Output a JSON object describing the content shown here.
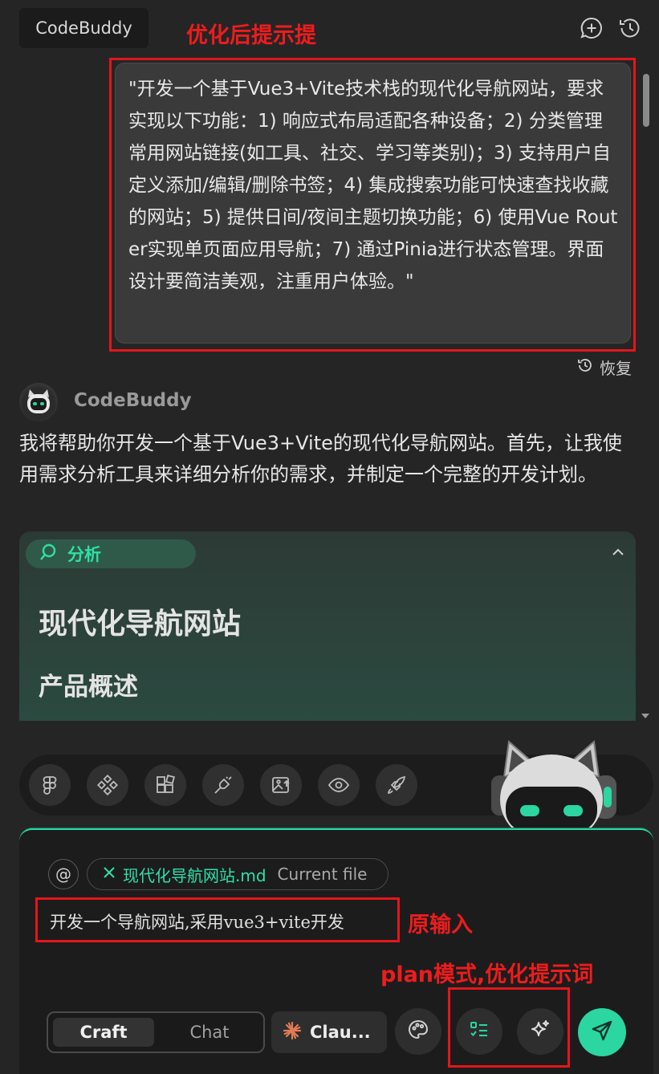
{
  "header": {
    "tab_label": "CodeBuddy",
    "new_chat_icon": "chat-plus-icon",
    "history_icon": "history-icon"
  },
  "annotations": {
    "optimized": "优化后提示提",
    "original": "原输入",
    "plan": "plan模式,优化提示词"
  },
  "prompt": {
    "text": "\"开发一个基于Vue3+Vite技术栈的现代化导航网站，要求实现以下功能：1) 响应式布局适配各种设备；2) 分类管理常用网站链接(如工具、社交、学习等类别)；3) 支持用户自定义添加/编辑/删除书签；4) 集成搜索功能可快速查找收藏的网站；5) 提供日间/夜间主题切换功能；6) 使用Vue Router实现单页面应用导航；7) 通过Pinia进行状态管理。界面设计要简洁美观，注重用户体验。\""
  },
  "restore_label": "恢复",
  "assistant": {
    "name": "CodeBuddy",
    "message": "我将帮助你开发一个基于Vue3+Vite的现代化导航网站。首先，让我使用需求分析工具来详细分析你的需求，并制定一个完整的开发计划。"
  },
  "analysis": {
    "label": "分析",
    "heading": "现代化导航网站",
    "subheading": "产品概述"
  },
  "toolbar": {
    "tools": [
      "figma-icon",
      "components-icon",
      "blocks-icon",
      "plugin-icon",
      "image-upload-icon",
      "preview-icon",
      "deploy-rocket-icon"
    ]
  },
  "input": {
    "at_symbol": "@",
    "file_name": "现代化导航网站.md",
    "file_meta": "Current file",
    "value": "开发一个导航网站,采用vue3+vite开发",
    "modes": {
      "craft": "Craft",
      "chat": "Chat"
    },
    "model_label": "Clau...",
    "accent": "#2bd6a0"
  }
}
